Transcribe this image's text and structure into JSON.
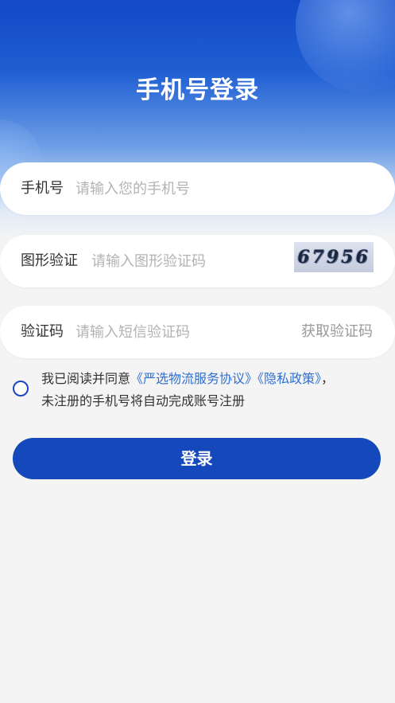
{
  "page": {
    "title": "手机号登录"
  },
  "phone": {
    "label": "手机号",
    "placeholder": "请输入您的手机号",
    "value": ""
  },
  "captcha": {
    "label": "图形验证",
    "placeholder": "请输入图形验证码",
    "image_text": "67956"
  },
  "sms": {
    "label": "验证码",
    "placeholder": "请输入短信验证码",
    "get_code_label": "获取验证码"
  },
  "agreement": {
    "checked": false,
    "prefix": "我已阅读并同意",
    "link_service": "《严选物流服务协议》",
    "link_privacy": "《隐私政策》",
    "suffix": "，",
    "note": "未注册的手机号将自动完成账号注册"
  },
  "login": {
    "label": "登录"
  },
  "colors": {
    "primary": "#1448bb",
    "link": "#2f6fd0",
    "background": "#f4f4f4"
  }
}
